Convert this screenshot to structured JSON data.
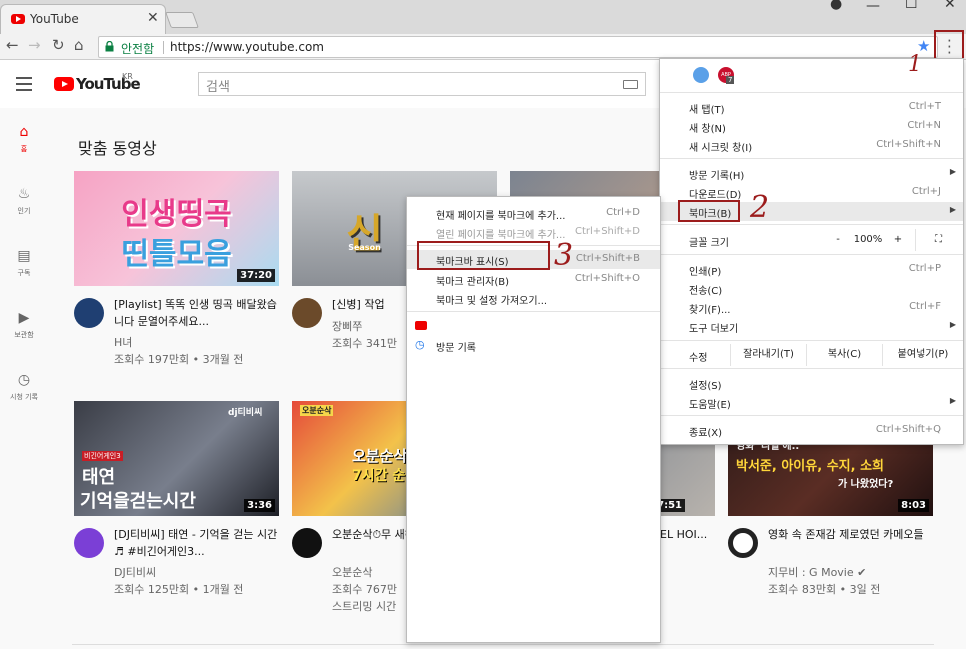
{
  "tab": {
    "title": "YouTube",
    "close": "✕"
  },
  "toolbar": {
    "secure_label": "안전함",
    "url": "https://www.youtube.com"
  },
  "youtube": {
    "logo_text": "YouTube",
    "region": "KR",
    "search_placeholder": "검색",
    "section_title": "맞춤 동영상"
  },
  "sidenav": [
    {
      "label": "홈",
      "icon": "home-icon"
    },
    {
      "label": "인기",
      "icon": "fire-icon"
    },
    {
      "label": "구독",
      "icon": "subscriptions-icon"
    },
    {
      "label": "보관함",
      "icon": "library-icon"
    },
    {
      "label": "시청 기록",
      "icon": "history-icon"
    }
  ],
  "videos": [
    {
      "thumb_line1": "인생띵곡",
      "thumb_line2": "띤틀모음",
      "duration": "37:20",
      "title": "[Playlist] 똑똑 인생 띵곡 배달왔습니다 문열어주세요...",
      "channel": "H녀",
      "meta": "조회수 197만회 • 3개월 전"
    },
    {
      "thumb_line1": "신",
      "thumb_line2": "Season",
      "duration": "",
      "title": "[신병] 작업",
      "channel": "장삐쭈",
      "meta": "조회수 341만"
    },
    {
      "thumb_line1": "",
      "thumb_line2": "",
      "duration": "",
      "title": "",
      "channel": "",
      "meta": ""
    },
    {
      "thumb_line1": "태연",
      "thumb_line2": "기억을걷는시간",
      "duration": "3:36",
      "thumb_tag": "비긴어게인3",
      "thumb_brand": "dj티비씨",
      "title": "[DJ티비씨] 태연 - 기억을 걷는 시간 ♬ #비긴어게인3...",
      "channel": "DJ티비씨",
      "meta": "조회수 125만회 • 1개월 전"
    },
    {
      "thumb_line1": "오분순삭 무",
      "thumb_line2": "7시간 순삭",
      "duration": "",
      "thumb_brand": "오분순삭",
      "title": "오분순삭⏱무 새해 기념 ★7",
      "channel": "오분순삭",
      "meta": "조회수 767만",
      "meta2": "스트리밍 시간"
    },
    {
      "thumb_line1": "",
      "thumb_line2": "",
      "duration": "7:51",
      "title": "EL HOI...",
      "channel": "",
      "meta": ""
    },
    {
      "thumb_line1": "영화 '리얼'에..",
      "thumb_line2": "박서준, 아이유, 수지, 소희",
      "thumb_line3": "가 나왔었다?",
      "duration": "8:03",
      "title": "영화 속 존재감 제로였던 카메오들",
      "channel": "지무비 : G Movie ✔",
      "meta": "조회수 83만회 • 3일 전"
    }
  ],
  "mainmenu": {
    "items1": [
      {
        "label": "새 탭(T)",
        "shortcut": "Ctrl+T"
      },
      {
        "label": "새 창(N)",
        "shortcut": "Ctrl+N"
      },
      {
        "label": "새 시크릿 창(I)",
        "shortcut": "Ctrl+Shift+N"
      }
    ],
    "items2": [
      {
        "label": "방문 기록(H)",
        "shortcut": ""
      },
      {
        "label": "다운로드(D)",
        "shortcut": "Ctrl+J"
      },
      {
        "label": "북마크(B)",
        "shortcut": ""
      }
    ],
    "zoom": {
      "label": "글꼴 크기",
      "minus": "-",
      "value": "100%",
      "plus": "+"
    },
    "items3": [
      {
        "label": "인쇄(P)",
        "shortcut": "Ctrl+P"
      },
      {
        "label": "전송(C)",
        "shortcut": ""
      },
      {
        "label": "찾기(F)...",
        "shortcut": "Ctrl+F"
      },
      {
        "label": "도구 더보기",
        "shortcut": ""
      }
    ],
    "edit": {
      "label": "수정",
      "cut": "잘라내기(T)",
      "copy": "복사(C)",
      "paste": "붙여넣기(P)"
    },
    "items4": [
      {
        "label": "설정(S)",
        "shortcut": ""
      },
      {
        "label": "도움말(E)",
        "shortcut": ""
      }
    ],
    "exit": {
      "label": "종료(X)",
      "shortcut": "Ctrl+Shift+Q"
    },
    "abp_badge": "7"
  },
  "submenu": {
    "items": [
      {
        "label": "현재 페이지를 북마크에 추가...",
        "shortcut": "Ctrl+D"
      },
      {
        "label": "열린 페이지를 북마크에 추가...",
        "shortcut": "Ctrl+Shift+D"
      },
      {
        "label": "북마크바 표시(S)",
        "shortcut": "Ctrl+Shift+B"
      },
      {
        "label": "북마크 관리자(B)",
        "shortcut": "Ctrl+Shift+O"
      },
      {
        "label": "북마크 및 설정 가져오기...",
        "shortcut": ""
      }
    ],
    "history_label": "방문 기록"
  },
  "annotations": [
    "1",
    "2",
    "3"
  ],
  "colors": {
    "yt_red": "#ff0000",
    "annotation": "#9c1c1c",
    "secure_green": "#0b8043"
  }
}
